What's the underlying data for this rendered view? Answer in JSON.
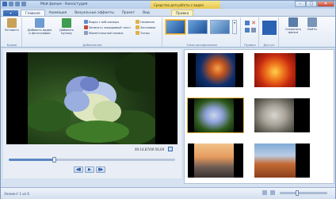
{
  "window": {
    "title": "Мой фильм - Киностудия",
    "context_caption": "Средства для работы с видео",
    "controls": {
      "minimize": "–",
      "maximize": "□",
      "close": "✕"
    }
  },
  "tabs": [
    {
      "label": "Главная",
      "active": true
    },
    {
      "label": "Анимация"
    },
    {
      "label": "Визуальные эффекты"
    },
    {
      "label": "Проект"
    },
    {
      "label": "Вид"
    },
    {
      "label": "Правка",
      "contextual": true
    }
  ],
  "ribbon": {
    "clipboard": {
      "paste": "Вставить",
      "group": "Буфер"
    },
    "add": {
      "add_video_photo": "Добавить видео и фотографии",
      "add_music": "Добавить музыку",
      "webcam_video": "Видео с веб-камеры",
      "record_narration": "Записать закадровый текст",
      "snapshot": "Моментальный снимок",
      "title": "Название",
      "caption": "Заголовок",
      "credits": "Титры",
      "group": "Добавление"
    },
    "themes": {
      "group": "Темы автофильмов"
    },
    "editing": {
      "group": "Правка"
    },
    "share": {
      "group": "Доступ"
    },
    "save": {
      "label": "Сохранить фильм"
    },
    "signin": {
      "label": "Войти"
    }
  },
  "player": {
    "timecode": "00:14,87/00:56,00",
    "seek_fraction": 0.27
  },
  "status": {
    "text": "Элемент 1 из 6"
  },
  "colors": {
    "accent": "#2e5ea8",
    "selection": "#f3b941"
  }
}
